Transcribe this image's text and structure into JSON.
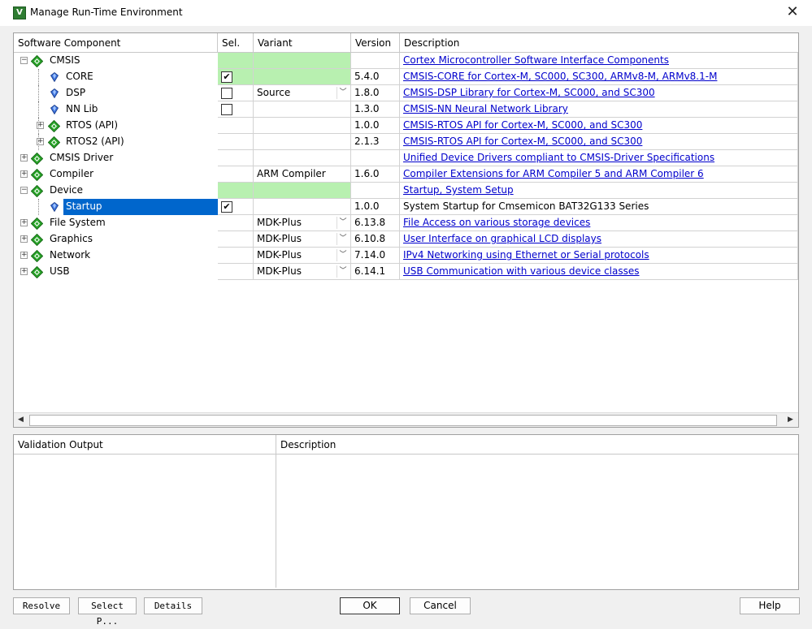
{
  "window": {
    "title": "Manage Run-Time Environment",
    "app_icon_letter": "V",
    "close_glyph": "✕"
  },
  "columns": {
    "component": "Software Component",
    "sel": "Sel.",
    "variant": "Variant",
    "version": "Version",
    "description": "Description"
  },
  "rows": [
    {
      "name": "CMSIS",
      "level": 0,
      "expander": "minus",
      "icon": "diamond-icon",
      "sel_green": true,
      "checkbox": null,
      "variant": "",
      "has_dropdown": false,
      "version": "",
      "description": "Cortex Microcontroller Software Interface Components",
      "link": true
    },
    {
      "name": "CORE",
      "level": 1,
      "expander": null,
      "icon": "gem-icon",
      "sel_green": true,
      "checkbox": true,
      "variant": "",
      "has_dropdown": false,
      "version": "5.4.0",
      "description": "CMSIS-CORE for Cortex-M, SC000, SC300, ARMv8-M, ARMv8.1-M",
      "link": true
    },
    {
      "name": "DSP",
      "level": 1,
      "expander": null,
      "icon": "gem-icon",
      "sel_green": false,
      "checkbox": false,
      "variant": "Source",
      "has_dropdown": true,
      "version": "1.8.0",
      "description": "CMSIS-DSP Library for Cortex-M, SC000, and SC300",
      "link": true
    },
    {
      "name": "NN Lib",
      "level": 1,
      "expander": null,
      "icon": "gem-icon",
      "sel_green": false,
      "checkbox": false,
      "variant": "",
      "has_dropdown": false,
      "version": "1.3.0",
      "description": "CMSIS-NN Neural Network Library",
      "link": true
    },
    {
      "name": "RTOS (API)",
      "level": 1,
      "expander": "plus",
      "icon": "diamond-icon",
      "sel_green": false,
      "checkbox": null,
      "variant": "",
      "has_dropdown": false,
      "version": "1.0.0",
      "description": "CMSIS-RTOS API for Cortex-M, SC000, and SC300",
      "link": true
    },
    {
      "name": "RTOS2 (API)",
      "level": 1,
      "expander": "plus",
      "icon": "diamond-icon",
      "sel_green": false,
      "checkbox": null,
      "variant": "",
      "has_dropdown": false,
      "version": "2.1.3",
      "description": "CMSIS-RTOS API for Cortex-M, SC000, and SC300",
      "link": true
    },
    {
      "name": "CMSIS Driver",
      "level": 0,
      "expander": "plus",
      "icon": "diamond-icon",
      "sel_green": false,
      "checkbox": null,
      "variant": "",
      "has_dropdown": false,
      "version": "",
      "description": "Unified Device Drivers compliant to CMSIS-Driver Specifications",
      "link": true
    },
    {
      "name": "Compiler",
      "level": 0,
      "expander": "plus",
      "icon": "diamond-icon",
      "sel_green": false,
      "checkbox": null,
      "variant": "ARM Compiler",
      "has_dropdown": false,
      "version": "1.6.0",
      "description": "Compiler Extensions for ARM Compiler 5 and ARM Compiler 6",
      "link": true
    },
    {
      "name": "Device",
      "level": 0,
      "expander": "minus",
      "icon": "diamond-icon",
      "sel_green": true,
      "checkbox": null,
      "variant": "",
      "has_dropdown": false,
      "version": "",
      "description": "Startup, System Setup",
      "link": true
    },
    {
      "name": "Startup",
      "level": 1,
      "expander": null,
      "icon": "gem-icon",
      "sel_green": false,
      "checkbox": true,
      "variant": "",
      "has_dropdown": false,
      "version": "1.0.0",
      "description": "System Startup for Cmsemicon BAT32G133 Series",
      "link": false,
      "selected": true
    },
    {
      "name": "File System",
      "level": 0,
      "expander": "plus",
      "icon": "diamond-icon",
      "sel_green": false,
      "checkbox": null,
      "variant": "MDK-Plus",
      "has_dropdown": true,
      "version": "6.13.8",
      "description": "File Access on various storage devices",
      "link": true
    },
    {
      "name": "Graphics",
      "level": 0,
      "expander": "plus",
      "icon": "diamond-icon",
      "sel_green": false,
      "checkbox": null,
      "variant": "MDK-Plus",
      "has_dropdown": true,
      "version": "6.10.8",
      "description": "User Interface on graphical LCD displays",
      "link": true
    },
    {
      "name": "Network",
      "level": 0,
      "expander": "plus",
      "icon": "diamond-icon",
      "sel_green": false,
      "checkbox": null,
      "variant": "MDK-Plus",
      "has_dropdown": true,
      "version": "7.14.0",
      "description": "IPv4 Networking using Ethernet or Serial protocols",
      "link": true
    },
    {
      "name": "USB",
      "level": 0,
      "expander": "plus",
      "icon": "diamond-icon",
      "sel_green": false,
      "checkbox": null,
      "variant": "MDK-Plus",
      "has_dropdown": true,
      "version": "6.14.1",
      "description": "USB Communication with various device classes",
      "link": true
    }
  ],
  "glyphs": {
    "check": "✔",
    "dropdown": "﹀",
    "plus": "+",
    "minus": "−",
    "left_arrow": "◀",
    "right_arrow": "▶"
  },
  "validation": {
    "output_header": "Validation Output",
    "description_header": "Description"
  },
  "buttons": {
    "resolve": "Resolve",
    "select_packs": "Select P...",
    "details": "Details",
    "ok": "OK",
    "cancel": "Cancel",
    "help": "Help"
  },
  "colors": {
    "selected_bg": "#0066cc",
    "green_cell": "#b8f0b0",
    "link": "#0000cc",
    "diamond": "#2aa52a"
  }
}
